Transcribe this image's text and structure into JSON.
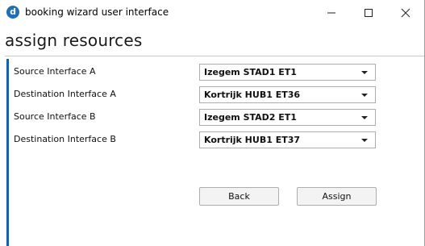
{
  "window": {
    "title": "booking wizard user interface",
    "icon_letter": "d",
    "accent_color": "#1a5fae"
  },
  "header": {
    "title": "assign resources"
  },
  "form": {
    "rows": [
      {
        "label": "Source Interface A",
        "value": "Izegem STAD1 ET1"
      },
      {
        "label": "Destination Interface A",
        "value": "Kortrijk HUB1 ET36"
      },
      {
        "label": "Source Interface B",
        "value": "Izegem STAD2 ET1"
      },
      {
        "label": "Destination Interface B",
        "value": "Kortrijk HUB1 ET37"
      }
    ]
  },
  "buttons": {
    "back_label": "Back",
    "assign_label": "Assign"
  },
  "icons": {
    "minimize": "minimize-icon",
    "maximize": "maximize-icon",
    "close": "close-icon",
    "dropdown": "chevron-down-icon"
  }
}
